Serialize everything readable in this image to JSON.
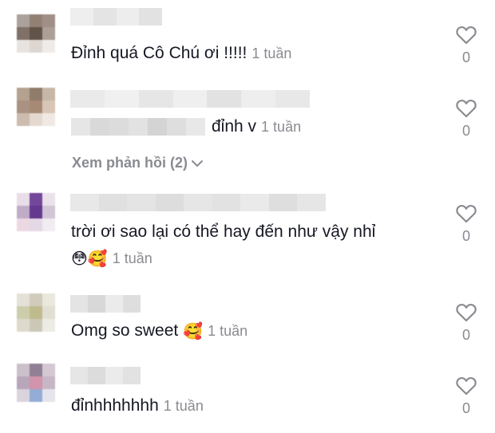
{
  "comments": [
    {
      "text": "Đỉnh quá Cô Chú ơi !!!!!",
      "time": "1 tuần",
      "likes": "0",
      "avatar_colors": [
        "#a89e98",
        "#8d7a6d",
        "#9b8a80",
        "#7a6a60",
        "#5a4a40",
        "#a89a90",
        "#e8e2de",
        "#dcd4cf",
        "#efeae7"
      ],
      "username_colors": [
        "#eeeeee",
        "#e4e4e4",
        "#ededed",
        "#e2e2e2"
      ]
    },
    {
      "prefix_blur_colors": [
        "#e6e6e6",
        "#d9d9d9",
        "#dcdcdc",
        "#e2e2e2",
        "#d4d4d4",
        "#dedede",
        "#e8e8e8"
      ],
      "text": "đỉnh v",
      "time": "1 tuần",
      "likes": "0",
      "avatar_colors": [
        "#b19c88",
        "#8b7564",
        "#c5b4a4",
        "#a68d7c",
        "#a3846d",
        "#d6c4b4",
        "#cbb9aa",
        "#e3d8cf",
        "#f0e8e2"
      ],
      "username_colors": [
        "#eaeaea",
        "#f0f0f0",
        "#e6e6e6",
        "#efefef",
        "#e2e2e2",
        "#eeeeee",
        "#e8e8e8"
      ]
    },
    {
      "text": "trời ơi sao lại có thể hay đến như vậy nhỉ",
      "emojis": "😳🥰",
      "time": "1 tuần",
      "likes": "0",
      "avatar_colors": [
        "#e8dce8",
        "#6c3e94",
        "#e9e0ea",
        "#bda8c4",
        "#5d2e8a",
        "#cfc2d4",
        "#ecd6e2",
        "#e2d6e4",
        "#f1ecf1"
      ],
      "username_colors": [
        "#e8e8e8",
        "#e0e0e0",
        "#e4e4e4",
        "#dddddd",
        "#e6e6e6",
        "#e2e2e2",
        "#eaeaea",
        "#dedede",
        "#e6e6e6"
      ]
    },
    {
      "text": "Omg so sweet",
      "emojis": "🥰",
      "time": "1 tuần",
      "likes": "0",
      "avatar_colors": [
        "#e4e0d6",
        "#cfc9b8",
        "#e9e6dc",
        "#cbcba8",
        "#bdb78a",
        "#e0ddd0",
        "#dcd8ca",
        "#c9c6b4",
        "#ecebe3"
      ],
      "username_colors": [
        "#e4e4e4",
        "#d8d8d8",
        "#ebebeb",
        "#dedede"
      ]
    },
    {
      "text": "đỉnhhhhhhh",
      "time": "1 tuần",
      "likes": "0",
      "avatar_colors": [
        "#c9bec9",
        "#8c7a90",
        "#d3c6d1",
        "#b5a2b8",
        "#cf8fa6",
        "#c4b3c3",
        "#d9d2dc",
        "#8fa8d4",
        "#e4e2ea"
      ],
      "username_colors": [
        "#e6e6e6",
        "#dcdcdc",
        "#ebebeb",
        "#e2e2e2"
      ]
    }
  ],
  "view_replies": "Xem phản hồi (2)",
  "colors": {
    "text": "#161823",
    "muted": "#8a8b91",
    "heart": "#8a8b91"
  }
}
